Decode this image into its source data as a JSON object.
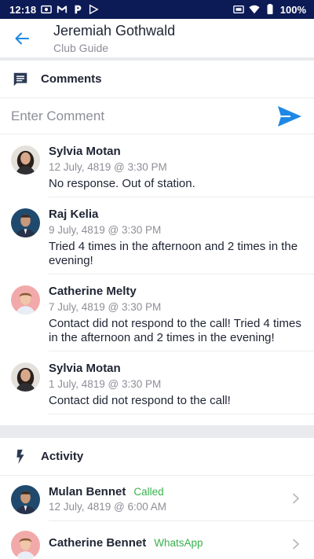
{
  "status_bar": {
    "time": "12:18",
    "left_icons": [
      "image-icon",
      "gmail-icon",
      "p-icon",
      "play-icon"
    ],
    "right_icons": [
      "cast-icon",
      "wifi-icon",
      "battery-icon"
    ],
    "battery": "100%"
  },
  "header": {
    "title": "Jeremiah Gothwald",
    "subtitle": "Club Guide"
  },
  "comments": {
    "section_title": "Comments",
    "input_placeholder": "Enter Comment",
    "items": [
      {
        "author": "Sylvia Motan",
        "time": "12 July, 4819 @ 3:30 PM",
        "text": "No response. Out of station.",
        "avatar": "woman-dark-hair"
      },
      {
        "author": "Raj Kelia",
        "time": "9 July, 4819 @ 3:30 PM",
        "text": "Tried 4 times in the afternoon and 2 times in the evening!",
        "avatar": "man-suit"
      },
      {
        "author": "Catherine Melty",
        "time": "7 July, 4819 @ 3:30 PM",
        "text": "Contact did not respond to the call! Tried 4 times in the afternoon and 2 times in the evening!",
        "avatar": "woman-pink-bg"
      },
      {
        "author": "Sylvia Motan",
        "time": "1 July, 4819 @ 3:30 PM",
        "text": "Contact did not respond to the call!",
        "avatar": "woman-dark-hair"
      }
    ]
  },
  "activity": {
    "section_title": "Activity",
    "items": [
      {
        "name": "Mulan Bennet",
        "type": "Called",
        "time": "12 July, 4819 @ 6:00 AM",
        "avatar": "man-suit"
      },
      {
        "name": "Catherine Bennet",
        "type": "WhatsApp",
        "time": "",
        "avatar": "woman-pink-bg"
      }
    ]
  },
  "colors": {
    "status_bar_bg": "#0c1a55",
    "accent_blue": "#1e88e5",
    "activity_type_green": "#37b24d",
    "muted_text": "#8d8f97"
  }
}
